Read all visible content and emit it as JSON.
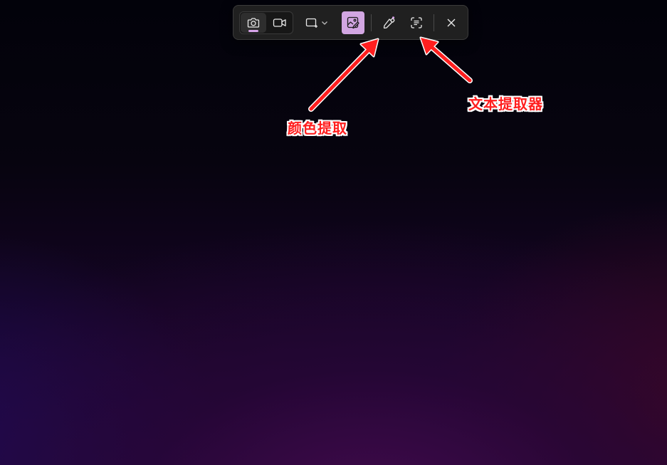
{
  "toolbar": {
    "modes": [
      {
        "name": "photo",
        "icon": "camera-icon",
        "selected": true
      },
      {
        "name": "video",
        "icon": "video-camera-icon",
        "selected": false
      }
    ],
    "shape_icon": "rectangle-select-icon",
    "dropdown_icon": "chevron-down-icon",
    "edit_icon": "image-edit-icon",
    "edit_active": true,
    "color_picker_icon": "eyedropper-icon",
    "text_extractor_icon": "text-scan-icon",
    "close_icon": "close-icon",
    "colors": {
      "toolbar_bg": "#202020",
      "accent": "#d2a6e2",
      "indicator": "#d7a4e8",
      "icon": "#e8e8e8"
    }
  },
  "annotations": {
    "color_picker_label": "颜色提取",
    "text_extractor_label": "文本提取器",
    "color": "#ff1f1f",
    "outline": "#ffffff"
  }
}
